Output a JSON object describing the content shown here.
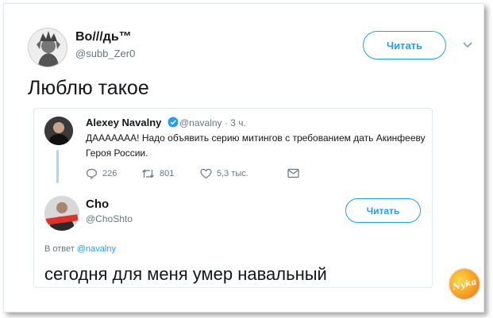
{
  "tweet": {
    "author_name": "Во///дь™",
    "author_handle": "@subb_Zer0",
    "follow_label": "Читать",
    "text": "Люблю такое"
  },
  "quoted_parent": {
    "author_name": "Alexey Navalny",
    "author_handle": "@navalny",
    "time": "· 3 ч.",
    "text": "ДААААААА! Надо объявить серию митингов с требованием дать Акинфееву Героя России.",
    "replies": "226",
    "retweets": "801",
    "likes": "5,3 тыс.",
    "verified_color": "#1da1f2"
  },
  "quoted_reply": {
    "author_name": "Cho",
    "author_handle": "@ChoShto",
    "follow_label": "Читать",
    "reply_to_prefix": "В ответ",
    "reply_to_handle": "@navalny",
    "text": "сегодня для меня умер навальный"
  },
  "watermark": {
    "text": "Nyka"
  },
  "colors": {
    "accent": "#1da1f2",
    "secondary_text": "#657786",
    "thread_line": "#a8d6f6"
  }
}
